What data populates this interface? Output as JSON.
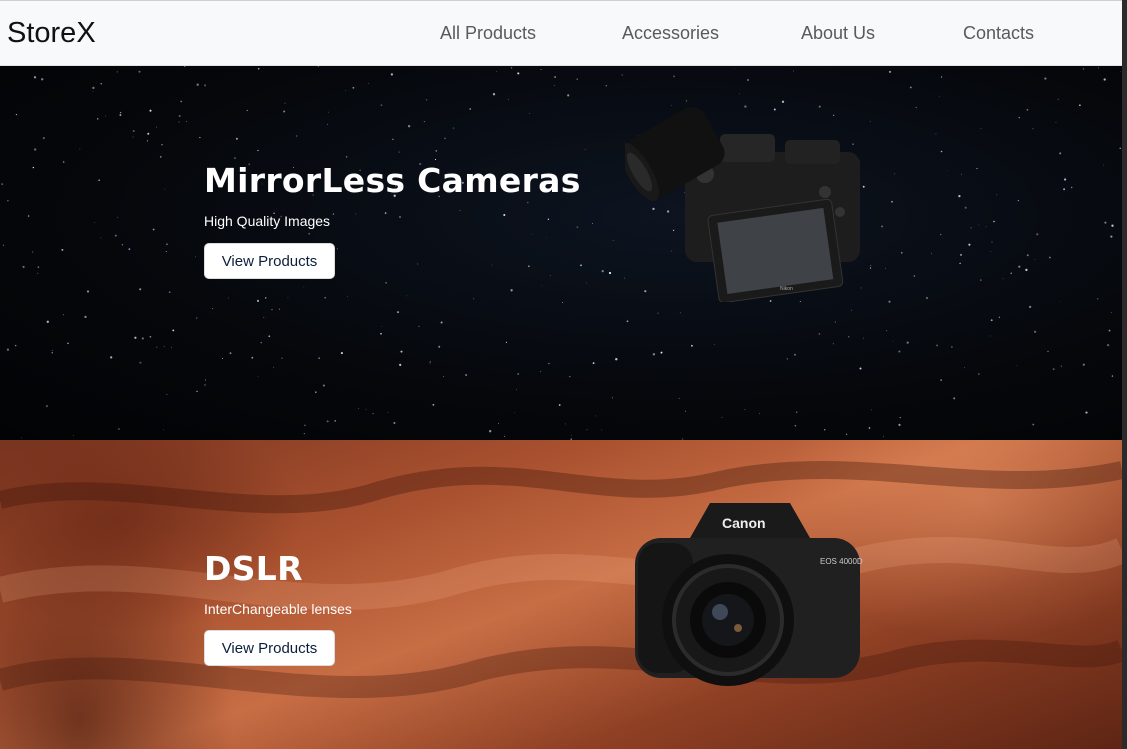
{
  "brand": "StoreX",
  "nav": [
    "All Products",
    "Accessories",
    "About Us",
    "Contacts"
  ],
  "heroes": [
    {
      "title": "MirrorLess Cameras",
      "subtitle": "High Quality Images",
      "button": "View Products"
    },
    {
      "title": "DSLR",
      "subtitle": "InterChangeable lenses",
      "button": "View Products"
    }
  ],
  "camera_brand": "Canon",
  "camera_model": "EOS 4000D",
  "mirrorless_brand": "Nikon",
  "colors": {
    "navbar_bg": "#f8f9fa",
    "button_text": "#0b1f3a"
  }
}
